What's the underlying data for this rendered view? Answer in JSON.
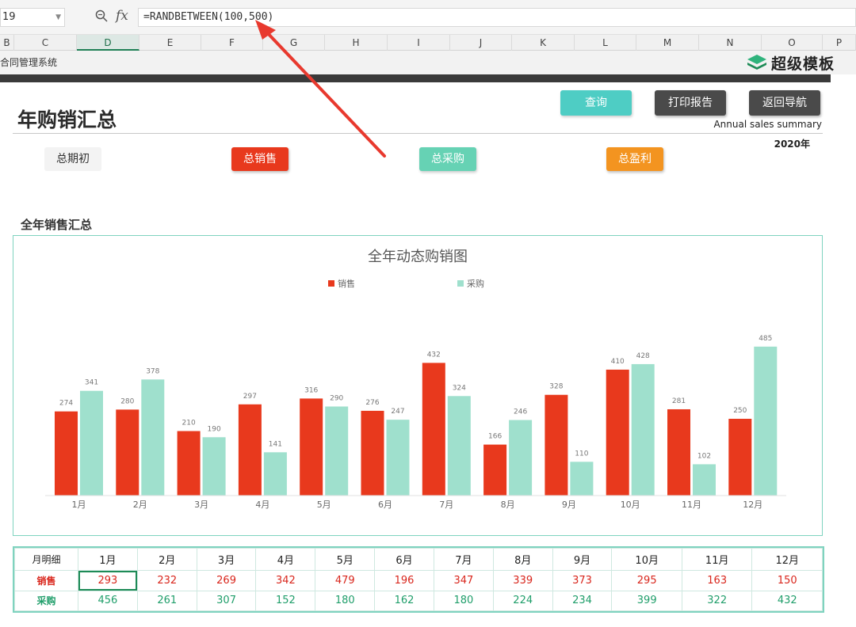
{
  "formula_bar": {
    "name_box": "19",
    "formula": "=RANDBETWEEN(100,500)"
  },
  "columns": [
    "B",
    "C",
    "D",
    "E",
    "F",
    "G",
    "H",
    "I",
    "J",
    "K",
    "L",
    "M",
    "N",
    "O",
    "P"
  ],
  "active_column": "D",
  "header": {
    "system_name": "合同管理系统",
    "logo_text": "超级模板",
    "logo_icon": "layers-icon"
  },
  "page": {
    "title": "年购销汇总",
    "subtitle_en": "Annual sales summary",
    "year": "2020年"
  },
  "buttons": {
    "query": "查询",
    "print": "打印报告",
    "back": "返回导航"
  },
  "kpis": {
    "begin": "总期初",
    "sales": "总销售",
    "purchase": "总采购",
    "profit": "总盈利"
  },
  "section_title": "全年销售汇总",
  "colors": {
    "sales": "#e8391d",
    "purchase": "#9fe0cd",
    "accent": "#4ecdc4",
    "dark": "#4a4a4a",
    "profit": "#f39420"
  },
  "chart_data": {
    "type": "bar",
    "title": "全年动态购销图",
    "categories": [
      "1月",
      "2月",
      "3月",
      "4月",
      "5月",
      "6月",
      "7月",
      "8月",
      "9月",
      "10月",
      "11月",
      "12月"
    ],
    "series": [
      {
        "name": "销售",
        "values": [
          274,
          280,
          210,
          297,
          316,
          276,
          432,
          166,
          328,
          410,
          281,
          250
        ]
      },
      {
        "name": "采购",
        "values": [
          341,
          378,
          190,
          141,
          290,
          247,
          324,
          246,
          110,
          428,
          102,
          485
        ]
      }
    ],
    "legend": "top-center",
    "data_labels": true,
    "grid": false
  },
  "table": {
    "corner": "月明细",
    "months": [
      "1月",
      "2月",
      "3月",
      "4月",
      "5月",
      "6月",
      "7月",
      "8月",
      "9月",
      "10月",
      "11月",
      "12月"
    ],
    "sales_label": "销售",
    "purchase_label": "采购",
    "sales": [
      293,
      232,
      269,
      342,
      479,
      196,
      347,
      339,
      373,
      295,
      163,
      150
    ],
    "purchase": [
      456,
      261,
      307,
      152,
      180,
      162,
      180,
      224,
      234,
      399,
      322,
      432
    ]
  }
}
